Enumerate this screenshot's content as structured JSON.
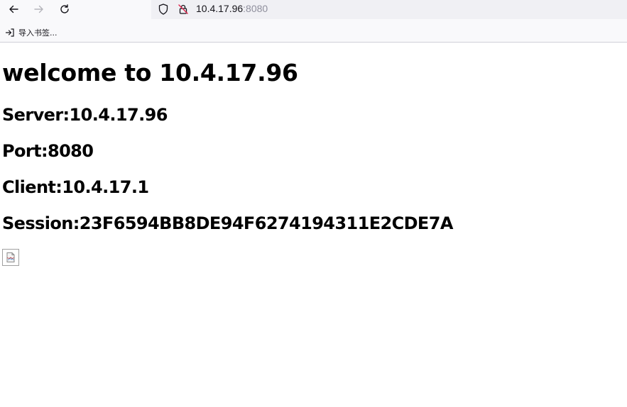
{
  "browser": {
    "url_host": "10.4.17.96",
    "url_port": ":8080",
    "bookmarks": [
      {
        "label": "导入书签..."
      }
    ]
  },
  "page": {
    "heading": "welcome to 10.4.17.96",
    "lines": [
      "Server:10.4.17.96",
      "Port:8080",
      "Client:10.4.17.1",
      "Session:23F6594BB8DE94F6274194311E2CDE7A"
    ]
  },
  "colors": {
    "toolbar_bg": "#f9f9fb",
    "urlbar_bg": "#f0f0f4",
    "url_port_color": "#8f8f9d",
    "lock_slash_color": "#e22850"
  }
}
